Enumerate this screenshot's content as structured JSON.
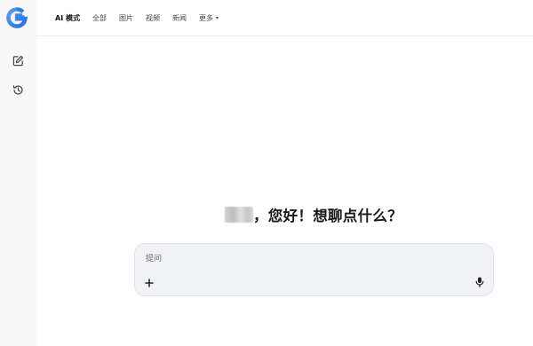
{
  "sidebar": {
    "logo_icon": "google-g-logo",
    "items": [
      {
        "icon": "edit-icon",
        "label": "new-chat"
      },
      {
        "icon": "history-icon",
        "label": "history"
      }
    ]
  },
  "nav": {
    "tabs": [
      {
        "label": "AI 模式",
        "active": true
      },
      {
        "label": "全部"
      },
      {
        "label": "图片"
      },
      {
        "label": "视频"
      },
      {
        "label": "新闻"
      },
      {
        "label": "更多"
      }
    ],
    "more_caret": "▾"
  },
  "greeting": {
    "text": "，您好！想聊点什么？"
  },
  "chat": {
    "placeholder": "提问",
    "plus_icon": "plus-icon",
    "mic_icon": "microphone-icon"
  },
  "colors": {
    "background": "#ffffff",
    "sidebar": "#f8f8f9",
    "input_bg": "#f1f2f5",
    "text": "#1f1f1f",
    "google_blue": "#4285f4"
  }
}
